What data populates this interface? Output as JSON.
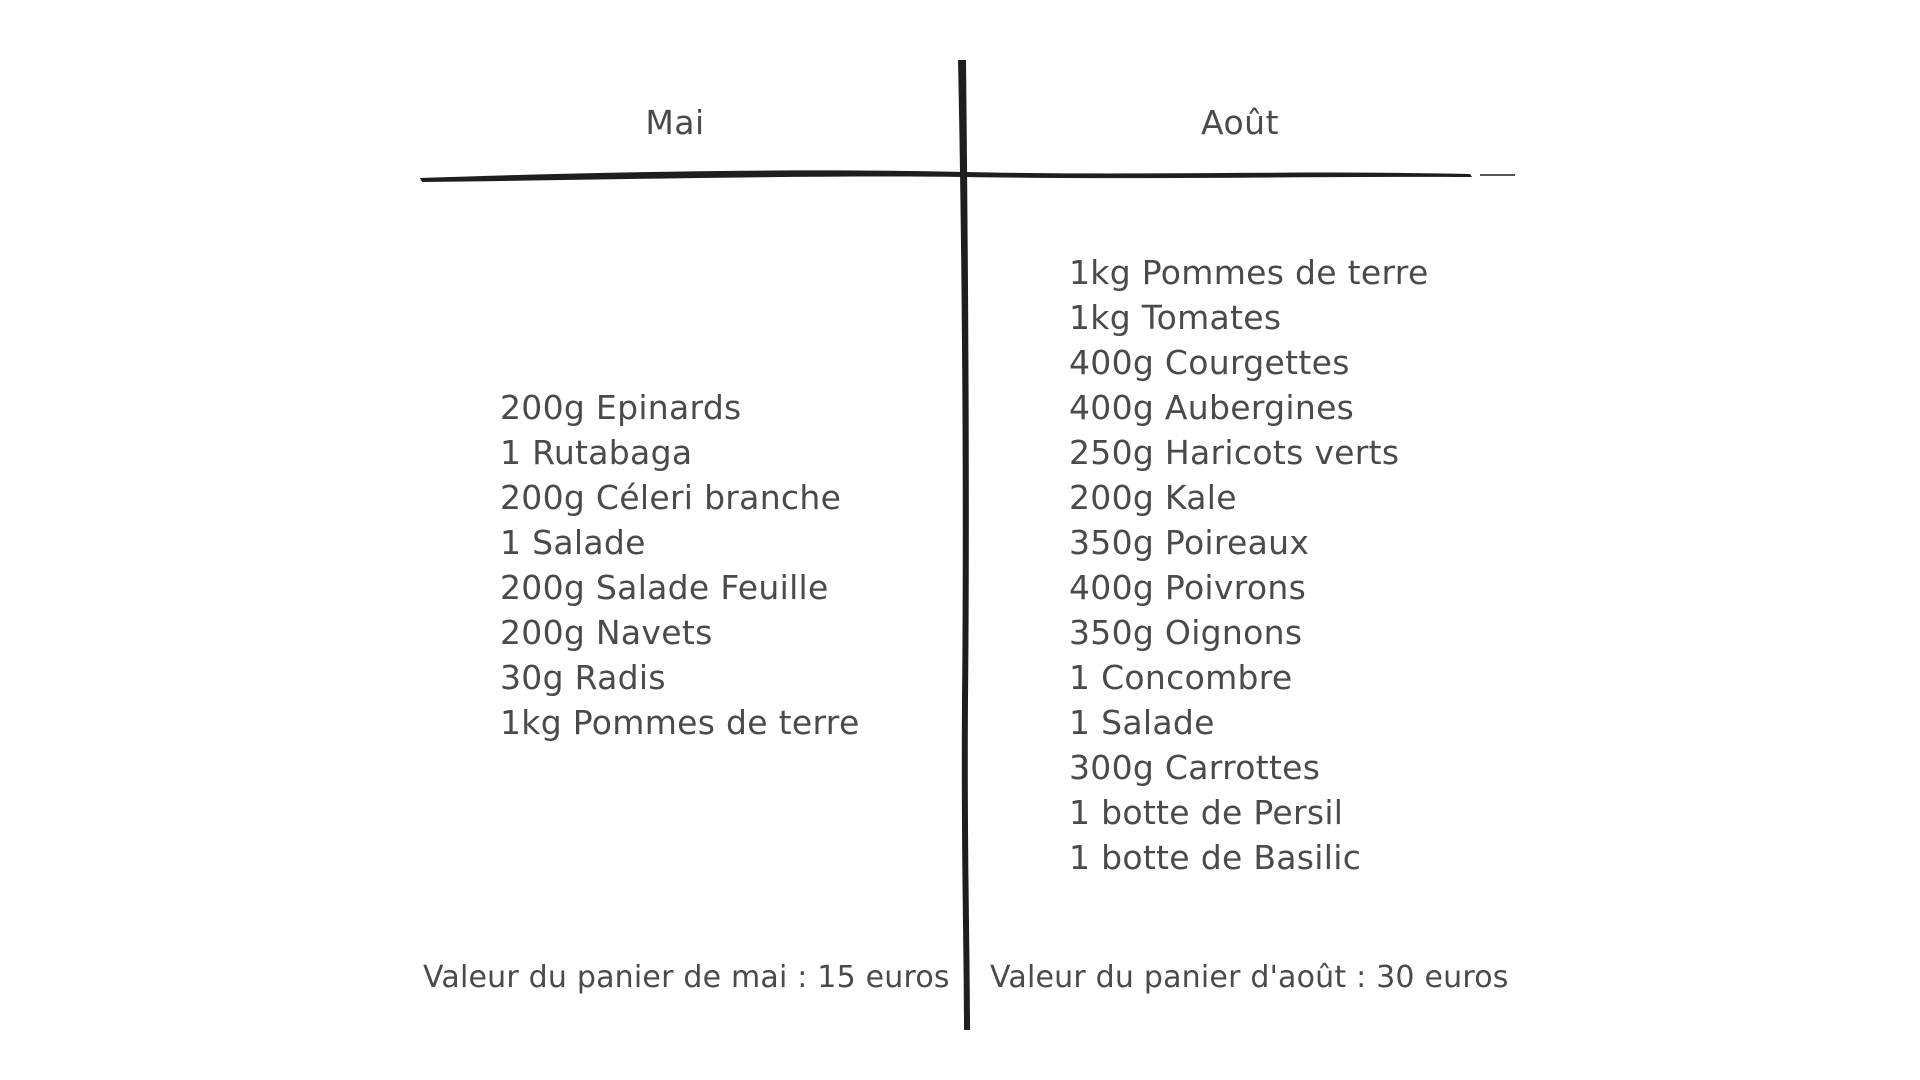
{
  "columns": [
    {
      "header": "Mai",
      "items": [
        "200g Epinards",
        "1 Rutabaga",
        "200g Céleri branche",
        "1 Salade",
        "200g Salade Feuille",
        "200g Navets",
        "30g Radis",
        "1kg Pommes de terre"
      ],
      "basket_value": "Valeur du panier de mai : 15 euros"
    },
    {
      "header": "Août",
      "items": [
        "1kg Pommes de terre",
        "1kg Tomates",
        "400g Courgettes",
        "400g Aubergines",
        "250g Haricots verts",
        "200g Kale",
        "350g Poireaux",
        "400g Poivrons",
        "350g Oignons",
        "1 Concombre",
        "1 Salade",
        "300g Carrottes",
        "1 botte de Persil",
        "1 botte de Basilic"
      ],
      "basket_value": "Valeur du panier d'août : 30 euros"
    }
  ],
  "colors": {
    "text": "#4a4a4a",
    "lines": "#1e1e1e",
    "background": "#ffffff"
  }
}
